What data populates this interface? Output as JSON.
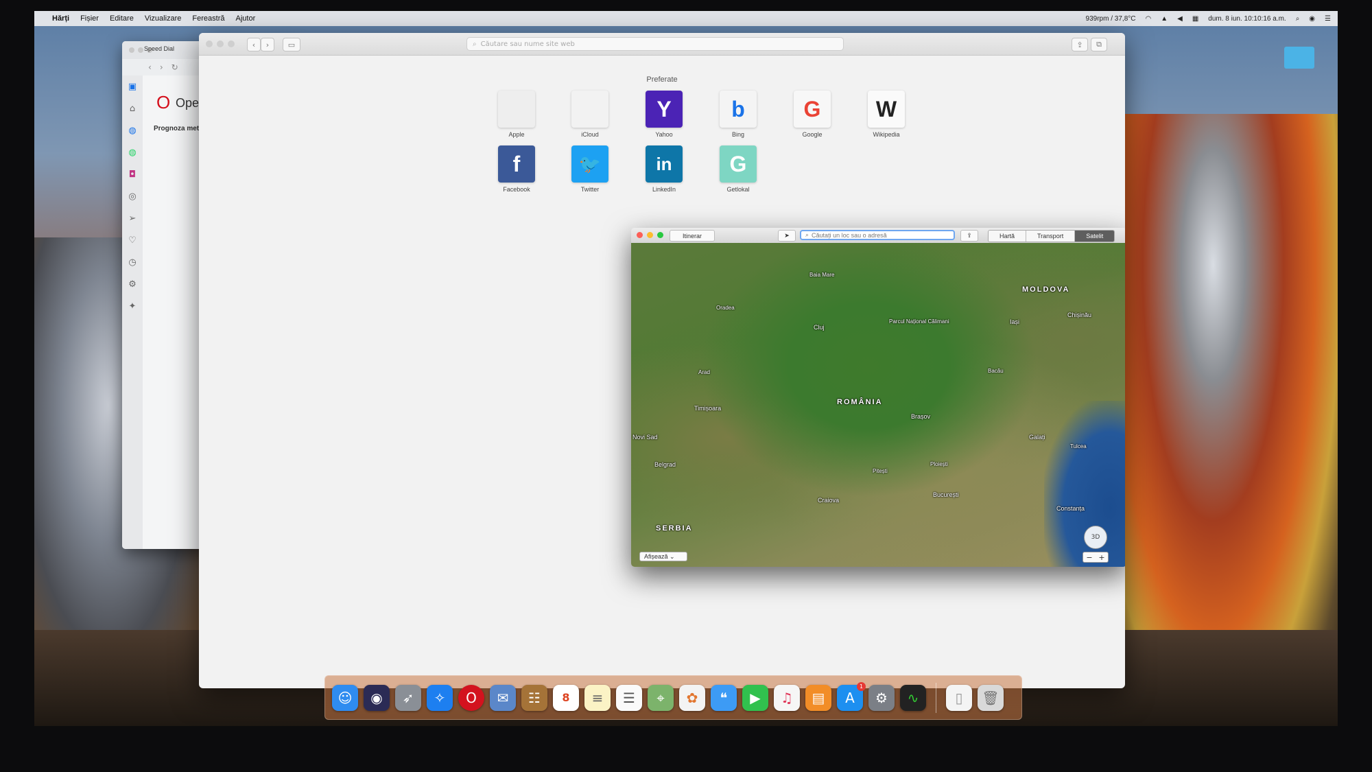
{
  "menubar": {
    "items": [
      "Hărți",
      "Fișier",
      "Editare",
      "Vizualizare",
      "Fereastră",
      "Ajutor"
    ],
    "status": "939rpm / 37,8°C",
    "datetime": "dum. 8 iun. 10:10:16 a.m."
  },
  "opera": {
    "tab_title": "Speed Dial",
    "logo_text": "Opera",
    "weather": "Prognoza meteo",
    "more": "..."
  },
  "safari": {
    "address_placeholder": "Căutare sau nume site web",
    "favorites_title": "Preferate",
    "favorites": [
      {
        "label": "Apple",
        "glyph": "",
        "bg": "#eeeeee",
        "fg": "#555555"
      },
      {
        "label": "iCloud",
        "glyph": "",
        "bg": "#f2f2f2",
        "fg": "#777777"
      },
      {
        "label": "Yahoo",
        "glyph": "Y",
        "bg": "#4b23b5",
        "fg": "#ffffff"
      },
      {
        "label": "Bing",
        "glyph": "b",
        "bg": "#f4f4f4",
        "fg": "#1a73e8"
      },
      {
        "label": "Google",
        "glyph": "G",
        "bg": "#f7f7f7",
        "fg": "#ea4335"
      },
      {
        "label": "Wikipedia",
        "glyph": "W",
        "bg": "#fafafa",
        "fg": "#222222"
      },
      {
        "label": "Facebook",
        "glyph": "f",
        "bg": "#3b5998",
        "fg": "#ffffff"
      },
      {
        "label": "Twitter",
        "glyph": "🐦",
        "bg": "#1da1f2",
        "fg": "#ffffff"
      },
      {
        "label": "LinkedIn",
        "glyph": "in",
        "bg": "#0e76a8",
        "fg": "#ffffff"
      },
      {
        "label": "Getlokal",
        "glyph": "G",
        "bg": "#7ed6c3",
        "fg": "#ffffff"
      }
    ]
  },
  "maps": {
    "route_button": "Itinerar",
    "search_placeholder": "Căutați un loc sau o adresă",
    "tabs": [
      "Hartă",
      "Transport",
      "Satelit"
    ],
    "active_tab": "Satelit",
    "show_select": "Afișează",
    "compass": "3D",
    "labels": {
      "country": "ROMÂNIA",
      "moldova": "MOLDOVA",
      "serbia": "SERBIA",
      "cluj": "Cluj",
      "iasi": "Iași",
      "chisinau": "Chișinău",
      "timisoara": "Timișoara",
      "brasov": "Brașov",
      "galati": "Galați",
      "bucuresti": "București",
      "craiova": "Craiova",
      "constanta": "Constanța",
      "belgrad": "Belgrad",
      "novi_sad": "Novi Sad",
      "park": "Parcul Național Călimani",
      "baia_mare": "Baia Mare",
      "oradea": "Oradea",
      "arad": "Arad",
      "tulcea": "Tulcea",
      "pitesti": "Pitești",
      "ploiesti": "Ploiești",
      "bacau": "Bacău"
    }
  },
  "dock": {
    "calendar_day": "8",
    "appstore_badge": "1"
  }
}
